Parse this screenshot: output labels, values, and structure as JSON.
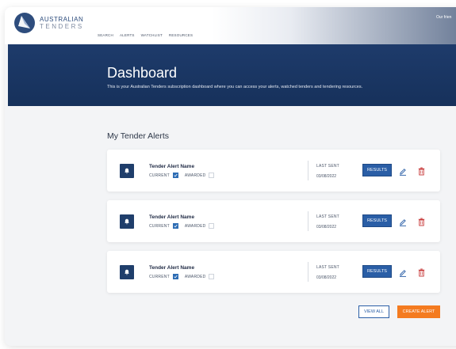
{
  "header": {
    "logo_line1": "AUSTRALIAN",
    "logo_line2": "TENDERS",
    "nav": [
      "SEARCH",
      "ALERTS",
      "WATCHLIST",
      "RESOURCES"
    ],
    "right_link": "Our frien"
  },
  "hero": {
    "title": "Dashboard",
    "subtitle": "This is your Australian Tenders subscription dashboard where you can access your alerts, watched tenders and tendering resources."
  },
  "alerts_section": {
    "title": "My Tender Alerts",
    "alerts": [
      {
        "name": "Tender Alert Name",
        "current_label": "CURRENT",
        "current_checked": true,
        "awarded_label": "AWARDED",
        "awarded_checked": false,
        "last_sent_label": "LAST SENT",
        "last_sent_date": "03/08/2022",
        "results_label": "RESULTS"
      },
      {
        "name": "Tender Alert Name",
        "current_label": "CURRENT",
        "current_checked": true,
        "awarded_label": "AWARDED",
        "awarded_checked": false,
        "last_sent_label": "LAST SENT",
        "last_sent_date": "03/08/2022",
        "results_label": "RESULTS"
      },
      {
        "name": "Tender Alert Name",
        "current_label": "CURRENT",
        "current_checked": true,
        "awarded_label": "AWARDED",
        "awarded_checked": false,
        "last_sent_label": "LAST SENT",
        "last_sent_date": "03/08/2022",
        "results_label": "RESULTS"
      }
    ],
    "view_all_label": "VIEW ALL",
    "create_alert_label": "CREATE ALERT"
  },
  "colors": {
    "brand_navy": "#1e3b6b",
    "primary_blue": "#2a5ea6",
    "accent_orange": "#f47b20",
    "delete_red": "#c53030"
  },
  "icons": [
    "logo-mark-icon",
    "bell-icon",
    "check-icon",
    "edit-pencil-icon",
    "trash-icon"
  ]
}
